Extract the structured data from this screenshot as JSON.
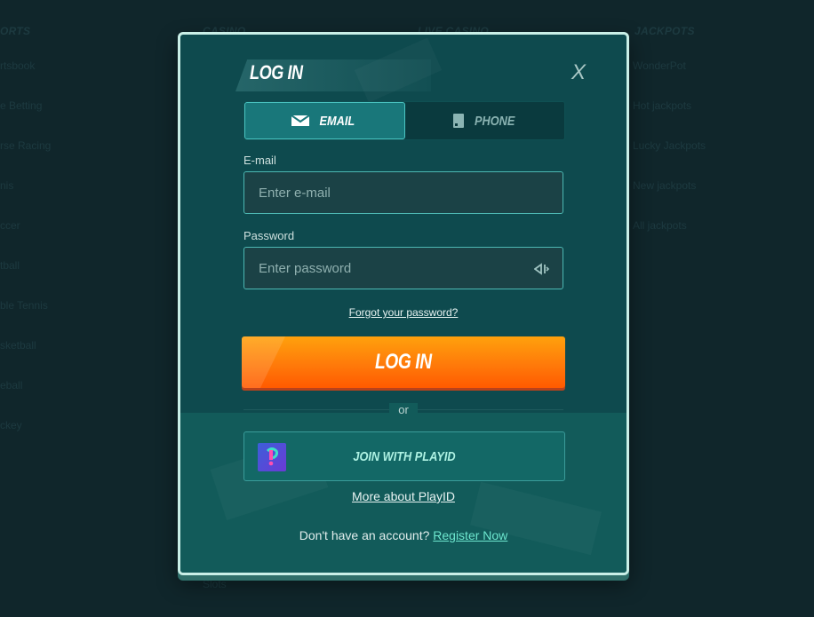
{
  "background": {
    "columns": [
      {
        "heading": "ORTS",
        "items": [
          "rtsbook",
          "e Betting",
          "rse Racing",
          "nis",
          "ccer",
          "tball",
          "ble Tennis",
          "sketball",
          "eball",
          "ckey"
        ]
      },
      {
        "heading": "CASINO",
        "items": [
          "Slots"
        ]
      },
      {
        "heading": "LIVE CASINO",
        "items": []
      },
      {
        "heading": "JACKPOTS",
        "items": [
          "WonderPot",
          "Hot jackpots",
          "Lucky Jackpots",
          "New jackpots",
          "All jackpots"
        ]
      }
    ]
  },
  "modal": {
    "title": "LOG IN",
    "close_label": "X",
    "tabs": [
      {
        "label": "EMAIL",
        "icon": "envelope-icon",
        "active": true
      },
      {
        "label": "PHONE",
        "icon": "phone-icon",
        "active": false
      }
    ],
    "email": {
      "label": "E-mail",
      "placeholder": "Enter e-mail",
      "value": ""
    },
    "password": {
      "label": "Password",
      "placeholder": "Enter password",
      "value": ""
    },
    "forgot_label": "Forgot your password?",
    "login_label": "LOG IN",
    "or_label": "or",
    "playid_label": "JOIN WITH PLAYID",
    "more_playid_label": "More about PlayID",
    "register_prompt": "Don't have an account?",
    "register_label": "Register Now"
  },
  "colors": {
    "accent": "#ff7a0a",
    "modal_bg": "#0e4a4e",
    "link": "#6ee7cf"
  }
}
